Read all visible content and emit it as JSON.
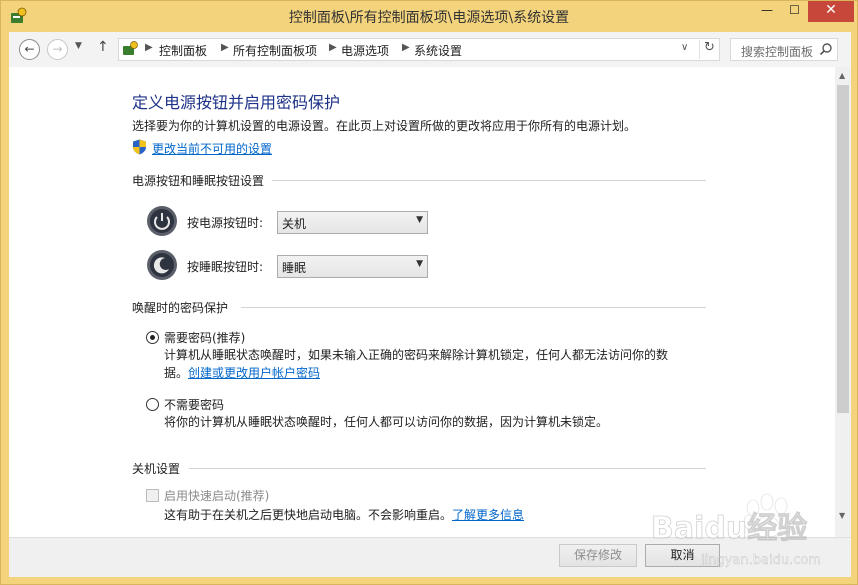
{
  "window": {
    "title": "控制面板\\所有控制面板项\\电源选项\\系统设置",
    "min_glyph": "—",
    "max_glyph": "☐",
    "close_glyph": "✕"
  },
  "nav": {
    "back_glyph": "←",
    "forward_glyph": "→",
    "up_glyph": "↑",
    "breadcrumbs": [
      "控制面板",
      "所有控制面板项",
      "电源选项",
      "系统设置"
    ],
    "search_placeholder": "搜索控制面板"
  },
  "page": {
    "title": "定义电源按钮并启用密码保护",
    "description": "选择要为你的计算机设置的电源设置。在此页上对设置所做的更改将应用于你所有的电源计划。",
    "change_link": "更改当前不可用的设置"
  },
  "power_section": {
    "heading": "电源按钮和睡眠按钮设置",
    "power_button": {
      "label": "按电源按钮时:",
      "value": "关机"
    },
    "sleep_button": {
      "label": "按睡眠按钮时:",
      "value": "睡眠"
    }
  },
  "password_section": {
    "heading": "唤醒时的密码保护",
    "require": {
      "label": "需要密码(推荐)",
      "selected": true,
      "desc_line1": "计算机从睡眠状态唤醒时，如果未输入正确的密码来解除计算机锁定，任何人都无法访问你的数",
      "desc_line2_prefix": "据。",
      "desc_link": "创建或更改用户帐户密码"
    },
    "no_require": {
      "label": "不需要密码",
      "selected": false,
      "desc": "将你的计算机从睡眠状态唤醒时，任何人都可以访问你的数据，因为计算机未锁定。"
    }
  },
  "shutdown_section": {
    "heading": "关机设置",
    "fast_startup": {
      "label": "启用快速启动(推荐)",
      "checked": false,
      "disabled": true,
      "desc": "这有助于在关机之后更快地启动电脑。不会影响重启。",
      "learn_more": "了解更多信息"
    }
  },
  "buttons": {
    "save": "保存修改",
    "cancel": "取消"
  },
  "watermark": {
    "brand": "Baidu经验",
    "url": "jingyan.baidu.com"
  },
  "colors": {
    "frame": "#f3d37c",
    "title_blue": "#1e3287",
    "link": "#0066cc",
    "close": "#c7483b"
  }
}
